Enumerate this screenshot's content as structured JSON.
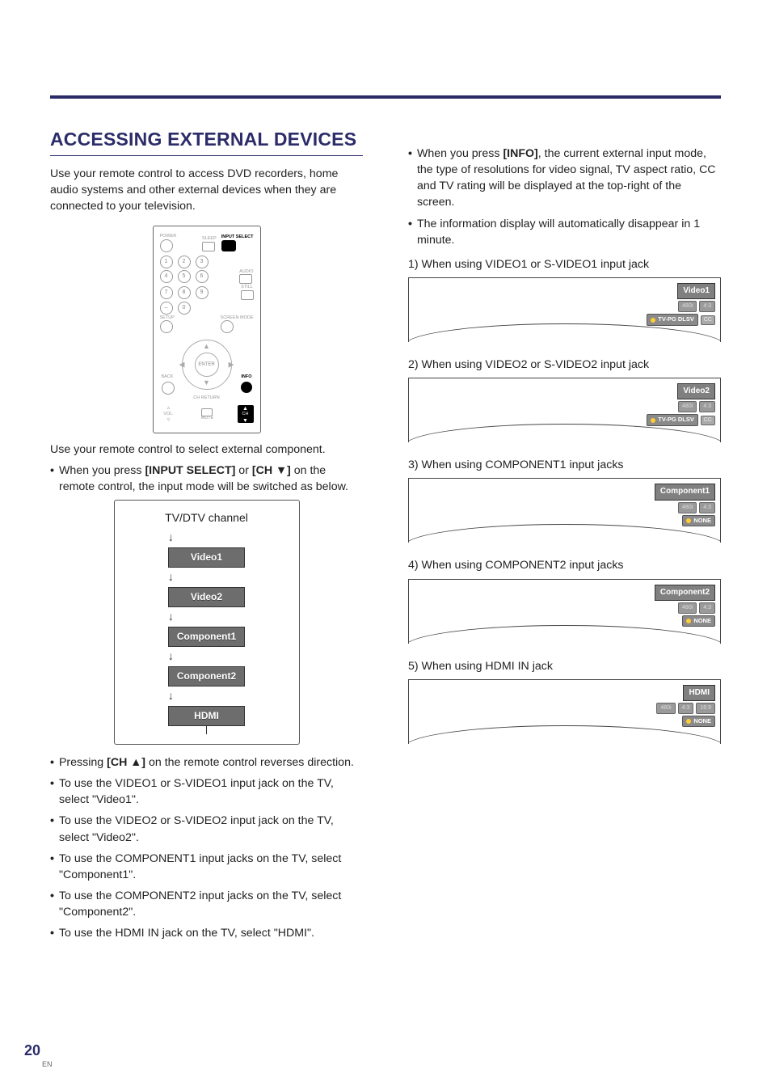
{
  "page": {
    "number": "20",
    "lang": "EN"
  },
  "title": "ACCESSING EXTERNAL DEVICES",
  "intro": "Use your remote control to access DVD recorders, home audio systems and other external devices when they are connected to your television.",
  "remote": {
    "labels": {
      "power": "POWER",
      "sleep": "SLEEP",
      "input_select": "INPUT SELECT",
      "audio": "AUDIO",
      "still": "STILL",
      "setup": "SETUP",
      "screen_mode": "SCREEN MODE",
      "enter": "ENTER",
      "back": "BACK",
      "info": "INFO",
      "ch_return": "CH RETURN",
      "vol": "VOL.",
      "mute": "MUTE",
      "ch": "CH"
    },
    "numpad": [
      "1",
      "2",
      "3",
      "4",
      "5",
      "6",
      "7",
      "8",
      "9",
      "–",
      "0"
    ]
  },
  "afterRemote": "Use your remote control to select external component.",
  "bullet_input_select": {
    "pre": "When you press ",
    "b1": "[INPUT SELECT]",
    "mid": " or ",
    "b2": "[CH ▼]",
    "post": " on the remote control, the input mode will be switched as below."
  },
  "flow": {
    "top": "TV/DTV channel",
    "items": [
      "Video1",
      "Video2",
      "Component1",
      "Component2",
      "HDMI"
    ]
  },
  "left_bullets": [
    {
      "pre": "Pressing ",
      "bold": "[CH ▲]",
      "post": " on the remote control reverses direction."
    },
    {
      "text": "To use the VIDEO1 or S-VIDEO1 input jack on the TV, select \"Video1\"."
    },
    {
      "text": "To use the VIDEO2 or S-VIDEO2 input jack on the TV, select \"Video2\"."
    },
    {
      "text": "To use the COMPONENT1 input jacks on the TV, select \"Component1\"."
    },
    {
      "text": "To use the COMPONENT2 input jacks on the TV, select \"Component2\"."
    },
    {
      "text": "To use the HDMI IN jack on the TV, select \"HDMI\"."
    }
  ],
  "right_top_bullets": [
    {
      "pre": "When you press ",
      "bold": "[INFO]",
      "post": ", the current external input mode, the type of resolutions for video signal, TV aspect ratio, CC and TV rating will be displayed at the top-right of the screen."
    },
    {
      "text": "The information display will automatically disappear in 1 minute."
    }
  ],
  "info_items": [
    {
      "heading": "1) When using VIDEO1 or S-VIDEO1 input jack",
      "title": "Video1",
      "chips": [
        "480i",
        "4:3"
      ],
      "rating": "TV-PG DLSV",
      "cc": "CC"
    },
    {
      "heading": "2) When using VIDEO2 or S-VIDEO2 input jack",
      "title": "Video2",
      "chips": [
        "480i",
        "4:3"
      ],
      "rating": "TV-PG DLSV",
      "cc": "CC"
    },
    {
      "heading": "3) When using COMPONENT1 input jacks",
      "title": "Component1",
      "chips": [
        "480i",
        "4:3"
      ],
      "rating": "NONE",
      "cc": ""
    },
    {
      "heading": "4) When using COMPONENT2 input jacks",
      "title": "Component2",
      "chips": [
        "480i",
        "4:3"
      ],
      "rating": "NONE",
      "cc": ""
    },
    {
      "heading": "5) When using HDMI IN jack",
      "title": "HDMI",
      "chips": [
        "480i",
        "4:3",
        "16:9"
      ],
      "rating": "NONE",
      "cc": ""
    }
  ]
}
